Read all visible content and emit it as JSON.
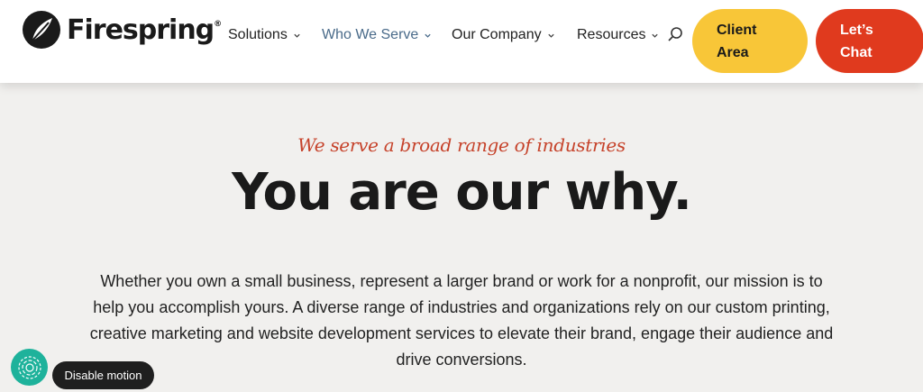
{
  "header": {
    "brand": "Firespring",
    "brand_mark": "®",
    "nav": [
      {
        "label": "Solutions"
      },
      {
        "label": "Who We Serve"
      },
      {
        "label": "Our Company"
      },
      {
        "label": "Resources"
      }
    ],
    "client_button": "Client\nArea",
    "chat_button": "Let’s\nChat"
  },
  "hero": {
    "eyebrow": "We serve a broad range of industries",
    "headline": "You are our why.",
    "body": "Whether you own a small business, represent a larger brand or work for a nonprofit, our mission is to help you accomplish yours. A diverse range of industries and organizations rely on our custom printing, creative marketing and website development services to elevate their brand, engage their audience and drive conversions."
  },
  "widget": {
    "motion_label": "Disable motion"
  },
  "colors": {
    "client_yellow": "#f8c638",
    "chat_red": "#e03a1e",
    "eyebrow_red": "#c6432b",
    "active_nav": "#4a6b8a",
    "a11y_teal": "#1eb29b"
  }
}
